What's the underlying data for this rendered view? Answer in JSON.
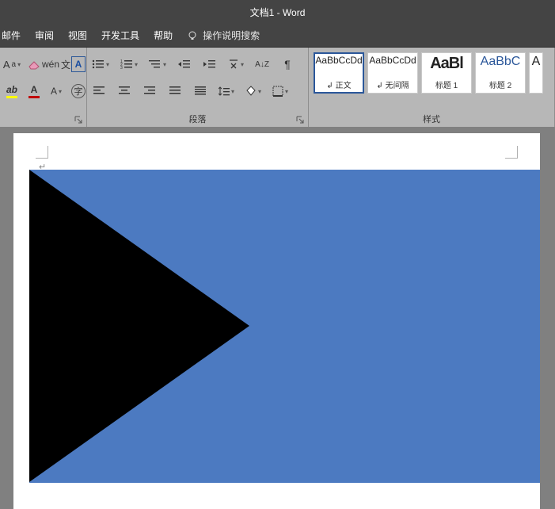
{
  "titlebar": {
    "title": "文档1 - Word"
  },
  "menubar": {
    "items": [
      "邮件",
      "审阅",
      "视图",
      "开发工具",
      "帮助"
    ],
    "tell_me": "操作说明搜索"
  },
  "ribbon": {
    "font": {
      "wen_label": "wén",
      "char_a": "A",
      "boxed_a": "A",
      "highlight_char": "A",
      "font_color_char": "A",
      "char_scale": "A",
      "char_enclose": "字"
    },
    "paragraph": {
      "label": "段落",
      "sort_az": "A↓Z",
      "show_marks": "¶"
    },
    "styles": {
      "label": "样式",
      "cards": [
        {
          "preview": "AaBbCcDd",
          "name": "↲ 正文",
          "big": false,
          "active": true
        },
        {
          "preview": "AaBbCcDd",
          "name": "↲ 无间隔",
          "big": false,
          "active": false
        },
        {
          "preview": "AaBl",
          "name": "标题 1",
          "big": true,
          "active": false
        },
        {
          "preview": "AaBbC",
          "name": "标题 2",
          "big": false,
          "active": false
        },
        {
          "preview": "A",
          "name": "",
          "big": false,
          "active": false
        }
      ]
    }
  },
  "document": {
    "shape": {
      "rect_fill": "#4c7ac1",
      "triangle_fill": "#000000"
    }
  }
}
